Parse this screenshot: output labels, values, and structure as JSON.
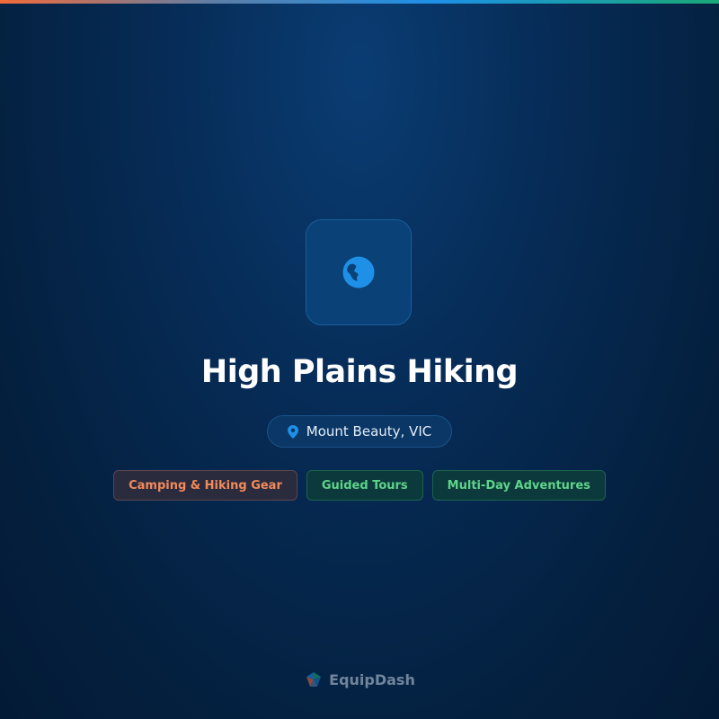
{
  "business": {
    "name": "High Plains Hiking",
    "location": "Mount Beauty, VIC",
    "logo_icon": "globe-icon"
  },
  "tags": [
    {
      "label": "Camping & Hiking Gear",
      "variant": "orange"
    },
    {
      "label": "Guided Tours",
      "variant": "green"
    },
    {
      "label": "Multi-Day Adventures",
      "variant": "green"
    }
  ],
  "footer": {
    "brand": "EquipDash"
  },
  "colors": {
    "accent_orange": "#f28a5a",
    "accent_green": "#5fd38a",
    "accent_blue": "#1e90e8",
    "background": "#04203f"
  }
}
